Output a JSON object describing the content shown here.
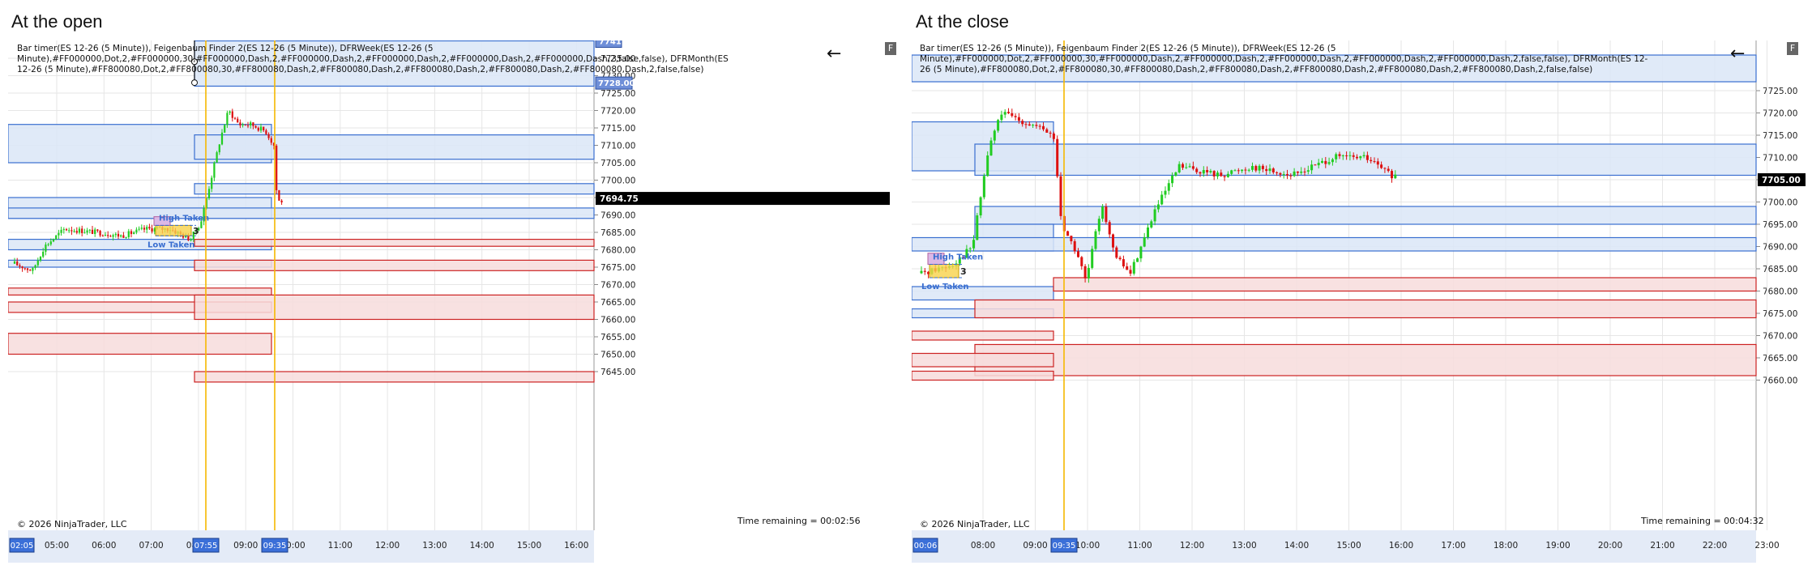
{
  "left": {
    "title": "At the open",
    "legend": "Bar timer(ES 12-26 (5 Minute)), Feigenbaum Finder 2(ES 12-26 (5 Minute)), DFRWeek(ES 12-26 (5 Minute),#FF000000,Dot,2,#FF000000,30,#FF000000,Dash,2,#FF000000,Dash,2,#FF000000,Dash,2,#FF000000,Dash,2,#FF000000,Dash,2,false,false), DFRMonth(ES 12-26 (5 Minute),#FF800080,Dot,2,#FF800080,30,#FF800080,Dash,2,#FF800080,Dash,2,#FF800080,Dash,2,#FF800080,Dash,2,#FF800080,Dash,2,false,false)",
    "copyright": "© 2026 NinjaTrader, LLC",
    "time_remaining": "Time remaining = 00:02:56",
    "arrow": "←",
    "f_button": "F",
    "price_ticks": [
      "7735.00",
      "7730.00",
      "7725.00",
      "7720.00",
      "7715.00",
      "7710.00",
      "7705.00",
      "7700.00",
      "7695.00",
      "7690.00",
      "7685.00",
      "7680.00",
      "7675.00",
      "7670.00",
      "7665.00",
      "7660.00",
      "7655.00",
      "7650.00",
      "7645.00"
    ],
    "time_ticks": [
      "05:00",
      "06:00",
      "07:00",
      "08:00",
      "09:00",
      "10:00",
      "11:00",
      "12:00",
      "13:00",
      "14:00",
      "15:00",
      "16:00"
    ],
    "time_start_label": "02:05",
    "cursor_time_a": "07:55",
    "cursor_time_b": "09:35",
    "last_price": "7694.75",
    "top_label": "7741",
    "level_label": "7728.00",
    "high_taken": "High Taken",
    "low_taken": "Low Taken",
    "count_label": "3"
  },
  "right": {
    "title": "At the close",
    "legend": "Bar timer(ES 12-26 (5 Minute)), Feigenbaum Finder 2(ES 12-26 (5 Minute)), DFRWeek(ES 12-26 (5 Minute),#FF000000,Dot,2,#FF000000,30,#FF000000,Dash,2,#FF000000,Dash,2,#FF000000,Dash,2,#FF000000,Dash,2,#FF000000,Dash,2,false,false), DFRMonth(ES 12-26 (5 Minute),#FF800080,Dot,2,#FF800080,30,#FF800080,Dash,2,#FF800080,Dash,2,#FF800080,Dash,2,#FF800080,Dash,2,#FF800080,Dash,2,false,false)",
    "copyright": "© 2026 NinjaTrader, LLC",
    "time_remaining": "Time remaining = 00:04:32",
    "arrow": "←",
    "f_button": "F",
    "price_ticks": [
      "7725.00",
      "7720.00",
      "7715.00",
      "7710.00",
      "7705.00",
      "7700.00",
      "7695.00",
      "7690.00",
      "7685.00",
      "7680.00",
      "7675.00",
      "7670.00",
      "7665.00",
      "7660.00"
    ],
    "time_ticks": [
      "08:00",
      "09:00",
      "10:00",
      "11:00",
      "12:00",
      "13:00",
      "14:00",
      "15:00",
      "16:00",
      "17:00",
      "18:00",
      "19:00",
      "20:00",
      "21:00",
      "22:00",
      "23:00"
    ],
    "time_start_label": "00:06",
    "cursor_time_a": "09:35",
    "last_price": "7705.00",
    "high_taken": "High Taken",
    "low_taken": "Low Taken",
    "count_label": "3"
  },
  "colors": {
    "up": "#22cc22",
    "down": "#dd1111",
    "blue_zone_fill": "#dbe6f7",
    "blue_zone_stroke": "#3a6fd0",
    "red_zone_fill": "#f7dcdc",
    "red_zone_stroke": "#cc2222",
    "axis_bg": "#e4ebf7",
    "cursor": "#f5b800",
    "grid": "#e6e6e6"
  }
}
